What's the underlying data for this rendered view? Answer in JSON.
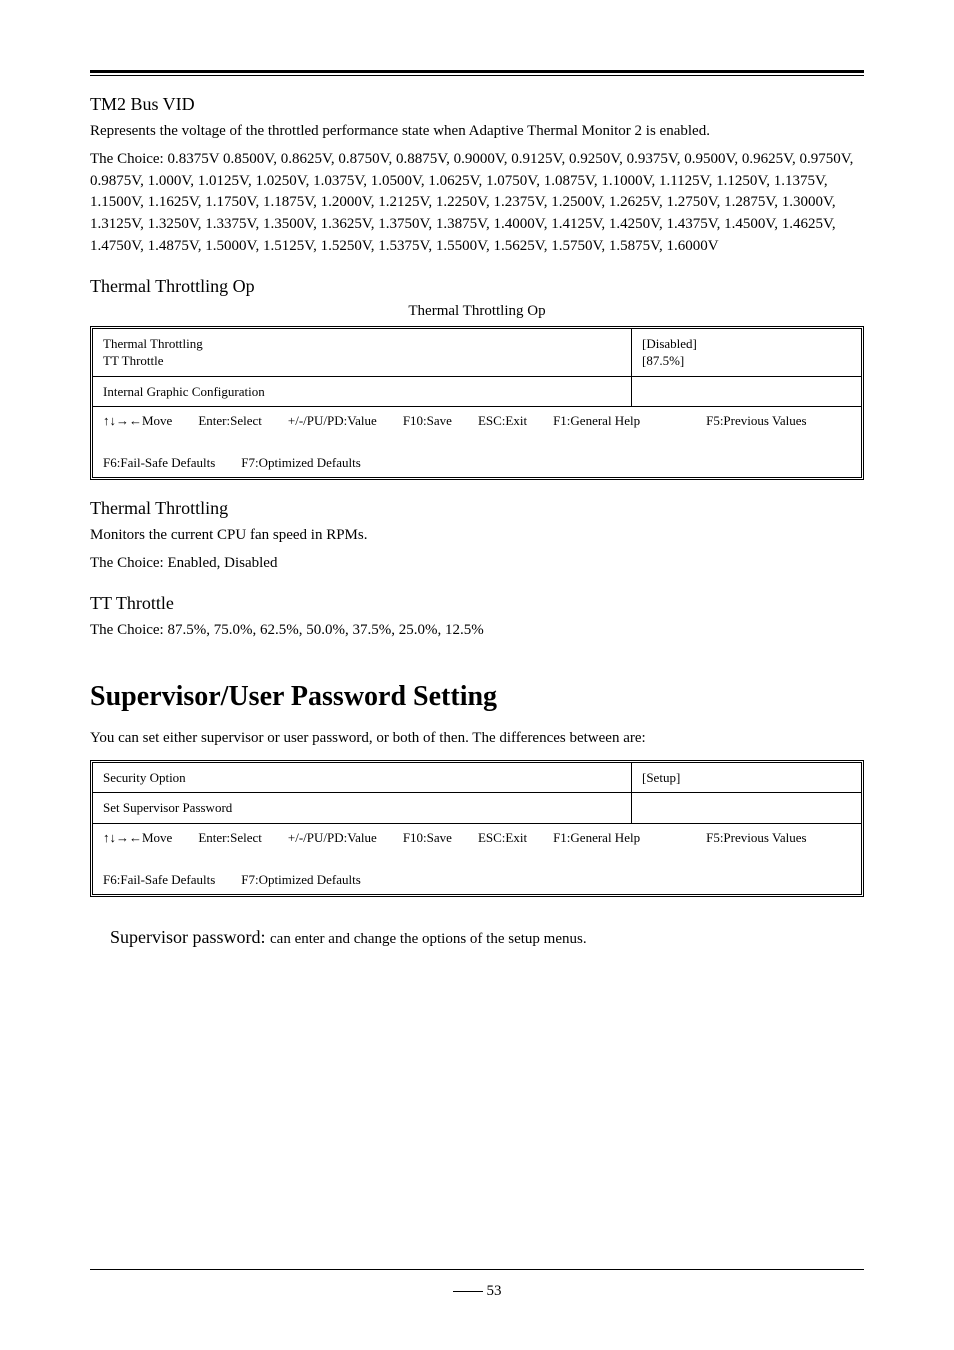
{
  "section1": {
    "title": "TM2 Bus VID",
    "desc": "Represents the voltage of the throttled performance state when Adaptive Thermal Monitor 2 is enabled.",
    "choices_label": "The Choice:",
    "choices": "0.8375V 0.8500V, 0.8625V, 0.8750V, 0.8875V, 0.9000V, 0.9125V, 0.9250V, 0.9375V, 0.9500V, 0.9625V, 0.9750V, 0.9875V, 1.000V, 1.0125V, 1.0250V, 1.0375V, 1.0500V, 1.0625V, 1.0750V, 1.0875V, 1.1000V, 1.1125V, 1.1250V, 1.1375V, 1.1500V, 1.1625V, 1.1750V, 1.1875V, 1.2000V, 1.2125V, 1.2250V, 1.2375V, 1.2500V, 1.2625V, 1.2750V, 1.2875V, 1.3000V, 1.3125V, 1.3250V, 1.3375V, 1.3500V, 1.3625V, 1.3750V, 1.3875V, 1.4000V, 1.4125V, 1.4250V, 1.4375V, 1.4500V, 1.4625V, 1.4750V, 1.4875V, 1.5000V, 1.5125V, 1.5250V, 1.5375V, 1.5500V, 1.5625V, 1.5750V, 1.5875V, 1.6000V"
  },
  "section2": {
    "title": "Thermal Throttling Op",
    "caption": "Thermal Throttling Op",
    "left1a": "Thermal Throttling",
    "left1b": "TT Throttle",
    "right1": "[Disabled]",
    "right2": "[87.5%]",
    "left2": "Internal Graphic Configuration",
    "footer_move": "Move",
    "footer_enter": "Enter:Select",
    "footer_pu": "+/-/PU/PD:Value",
    "footer_save": "F10:Save",
    "footer_esc": "ESC:Exit",
    "footer_f1": "F1:General Help",
    "footer_f5": "F5:Previous Values",
    "footer_f6": "F6:Fail-Safe Defaults",
    "footer_f7": "F7:Optimized Defaults"
  },
  "section3": {
    "title": "Thermal Throttling",
    "desc": "Monitors the current CPU fan speed in RPMs.",
    "choices_label": "The Choice:",
    "choices": "Enabled, Disabled"
  },
  "section4": {
    "title": "TT Throttle",
    "choices_label": "The Choice:",
    "choices": "87.5%, 75.0%, 62.5%, 50.0%, 37.5%, 25.0%, 12.5%"
  },
  "security_heading": "Supervisor/User Password Setting",
  "security_para": "You can set either supervisor or user password, or both of then. The differences between are:",
  "bios2": {
    "left1": "Security Option",
    "right1": "[Setup]",
    "left2": "Set Supervisor Password",
    "footer_move": "Move",
    "footer_enter": "Enter:Select",
    "footer_pu": "+/-/PU/PD:Value",
    "footer_save": "F10:Save",
    "footer_esc": "ESC:Exit",
    "footer_f1": "F1:General Help",
    "footer_f5": "F5:Previous Values",
    "footer_f6": "F6:Fail-Safe Defaults",
    "footer_f7": "F7:Optimized Defaults"
  },
  "sup_label": "Supervisor password:",
  "sup_text": "can enter and change the options of the setup menus.",
  "page_number": "53"
}
